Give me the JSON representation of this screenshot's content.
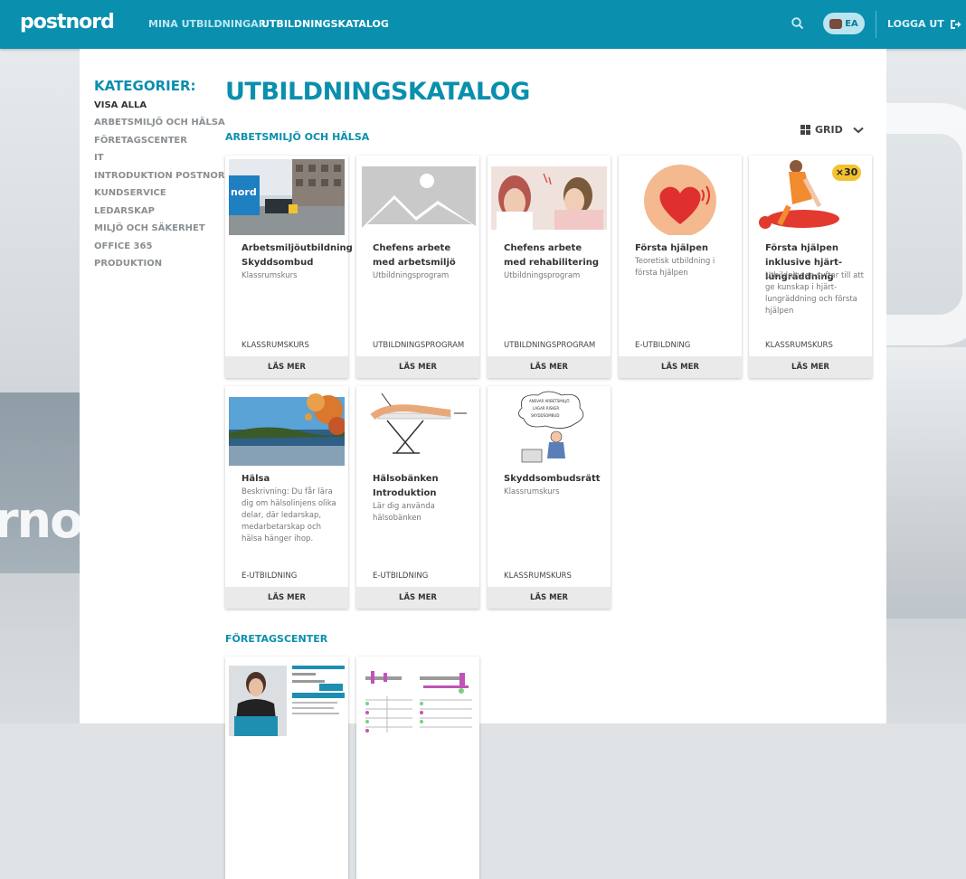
{
  "header": {
    "logo": "postnord",
    "nav": [
      "MINA UTBILDNINGAR",
      "UTBILDNINGSKATALOG"
    ],
    "user_initials": "EA",
    "logout": "LOGGA UT"
  },
  "sidebar": {
    "title": "KATEGORIER:",
    "items": [
      "VISA ALLA",
      "ARBETSMILJÖ OCH HÄLSA",
      "FÖRETAGSCENTER",
      "IT",
      "INTRODUKTION POSTNORD",
      "KUNDSERVICE",
      "LEDARSKAP",
      "MILJÖ OCH SÄKERHET",
      "OFFICE 365",
      "PRODUKTION"
    ]
  },
  "main": {
    "title": "UTBILDNINGSKATALOG",
    "view_toggle": "GRID",
    "sections": [
      {
        "title": "ARBETSMILJÖ OCH HÄLSA",
        "cards": [
          {
            "title": "Arbetsmiljöutbildning Skyddsombud",
            "desc": "Klassrumskurs",
            "type": "KLASSRUMSKURS",
            "button": "LÄS MER",
            "thumb": "street-photo"
          },
          {
            "title": "Chefens arbete med arbetsmiljö",
            "desc": "Utbildningsprogram",
            "type": "UTBILDNINGSPROGRAM",
            "button": "LÄS MER",
            "thumb": "placeholder-image-icon"
          },
          {
            "title": "Chefens arbete med rehabilitering",
            "desc": "Utbildningsprogram",
            "type": "UTBILDNINGSPROGRAM",
            "button": "LÄS MER",
            "thumb": "people-photo"
          },
          {
            "title": "Första hjälpen",
            "desc": "Teoretisk utbildning i första hjälpen",
            "type": "E-UTBILDNING",
            "button": "LÄS MER",
            "thumb": "heart-icon"
          },
          {
            "title": "Första hjälpen inklusive hjärt-lungräddning",
            "desc": "Utbildningen syftar till att ge kunskap i hjärt-lungräddning och första hjälpen",
            "type": "KLASSRUMSKURS",
            "button": "LÄS MER",
            "thumb": "cpr-illustration",
            "badge": "×30"
          },
          {
            "title": "Hälsa",
            "desc": "Beskrivning: Du får lära dig om hälsolinjens olika delar, där ledarskap, medarbetarskap och hälsa hänger ihop.",
            "type": "E-UTBILDNING",
            "button": "LÄS MER",
            "thumb": "autumn-landscape-photo",
            "thumb_label": "Hälsa"
          },
          {
            "title": "Hälsobänken Introduktion",
            "desc": "Lär dig använda hälsobänken",
            "type": "E-UTBILDNING",
            "button": "LÄS MER",
            "thumb": "bench-illustration"
          },
          {
            "title": "Skyddsombudsrätt",
            "desc": "Klassrumskurs",
            "type": "KLASSRUMSKURS",
            "button": "LÄS MER",
            "thumb": "worried-person-illustration"
          }
        ]
      },
      {
        "title": "FÖRETAGSCENTER",
        "cards": [
          {
            "thumb": "person-photo"
          },
          {
            "thumb": "diagram-screenshot"
          }
        ]
      }
    ]
  }
}
